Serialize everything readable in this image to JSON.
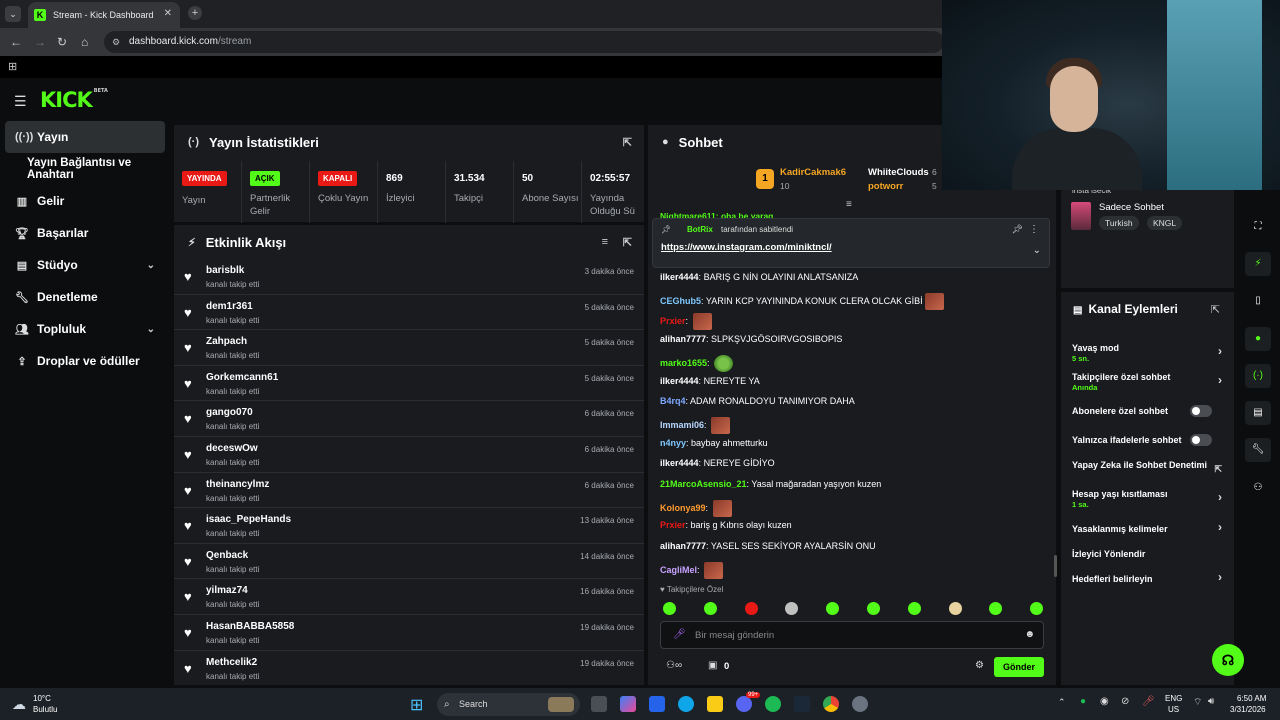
{
  "browser": {
    "tab_title": "Stream - Kick Dashboard",
    "url_host": "dashboard.kick.com",
    "url_path": "/stream"
  },
  "brand": {
    "logo": "KICK",
    "beta": "BETA",
    "accent": "#53fc18"
  },
  "sidebar": {
    "items": [
      {
        "label": "Yayın",
        "icon": "broadcast-icon",
        "active": true
      },
      {
        "label": "Yayın Bağlantısı ve Anahtarı"
      },
      {
        "label": "Gelir",
        "icon": "revenue-icon"
      },
      {
        "label": "Başarılar",
        "icon": "trophy-icon"
      },
      {
        "label": "Stüdyo",
        "icon": "studio-icon"
      },
      {
        "label": "Denetleme",
        "icon": "wrench-icon"
      },
      {
        "label": "Topluluk",
        "icon": "community-icon"
      },
      {
        "label": "Droplar ve ödüller",
        "icon": "drops-icon"
      }
    ]
  },
  "stats": {
    "title": "Yayın İstatistikleri",
    "items": [
      {
        "badge": "YAYINDA",
        "label": "Yayın"
      },
      {
        "badge": "AÇIK",
        "label": "Partnerlik Gelir"
      },
      {
        "badge": "KAPALI",
        "label": "Çoklu Yayın"
      },
      {
        "value": "869",
        "label": "İzleyici"
      },
      {
        "value": "31.534",
        "label": "Takipçi"
      },
      {
        "value": "50",
        "label": "Abone Sayısı"
      },
      {
        "value": "02:55:57",
        "label": "Yayında Olduğu Sü"
      }
    ]
  },
  "activity": {
    "title": "Etkinlik Akışı",
    "event_label": "kanalı takip etti",
    "rows": [
      {
        "name": "barisblk",
        "time": "3 dakika önce"
      },
      {
        "name": "dem1r361",
        "time": "5 dakika önce"
      },
      {
        "name": "Zahpach",
        "time": "5 dakika önce"
      },
      {
        "name": "Gorkemcann61",
        "time": "5 dakika önce"
      },
      {
        "name": "gango070",
        "time": "6 dakika önce"
      },
      {
        "name": "deceswOw",
        "time": "6 dakika önce"
      },
      {
        "name": "theinancylmz",
        "time": "6 dakika önce"
      },
      {
        "name": "isaac_PepeHands",
        "time": "13 dakika önce"
      },
      {
        "name": "Qenback",
        "time": "14 dakika önce"
      },
      {
        "name": "yilmaz74",
        "time": "16 dakika önce"
      },
      {
        "name": "HasanBABBA5858",
        "time": "19 dakika önce"
      },
      {
        "name": "Methcelik2",
        "time": "19 dakika önce"
      }
    ]
  },
  "chat": {
    "title": "Sohbet",
    "top_gifters": [
      {
        "rank": "1",
        "name": "KadirCakmak6",
        "count": "10"
      },
      {
        "name": "WhiiteClouds",
        "count": "6"
      },
      {
        "name": "potworr",
        "count": "5"
      }
    ],
    "partial_top": "Nightmare611: oha be yarag",
    "pinned": {
      "by": "BotRix",
      "by_suffix": "tarafından sabitlendi",
      "link": "https://www.instagram.com/miniktncl/"
    },
    "messages": [
      {
        "user": "ilker4444",
        "color": "#ffffff",
        "text": "BARIŞ G NİN OLAYINI ANLATSANIZA"
      },
      {
        "user": "CEGhub5",
        "color": "#7ec8ff",
        "text": "YARIN KCP YAYININDA KONUK CLERA OLCAK GİBİ",
        "emote": true
      },
      {
        "user": "Prxier",
        "color": "#e91916",
        "text": "",
        "emote": true
      },
      {
        "user": "alihan7777",
        "color": "#ffffff",
        "text": "SLPKŞVJGÖSOIRVGOSIBOPIS"
      },
      {
        "user": "marko1655",
        "color": "#53fc18",
        "text": "",
        "emote": "frog"
      },
      {
        "user": "ilker4444",
        "color": "#ffffff",
        "text": "NEREYTE YA"
      },
      {
        "user": "B4rq4",
        "color": "#7ea8ff",
        "text": "ADAM RONALDOYU TANIMIYOR DAHA"
      },
      {
        "user": "Immami06",
        "color": "#b8d8ff",
        "text": "",
        "emote": true
      },
      {
        "user": "n4nyy",
        "color": "#7ec8ff",
        "text": "baybay ahmetturku"
      },
      {
        "user": "ilker4444",
        "color": "#ffffff",
        "text": "NEREYE GİDİYO"
      },
      {
        "user": "21MarcoAsensio_21",
        "color": "#53fc18",
        "text": "Yasal mağaradan yaşıyon kuzen"
      },
      {
        "user": "Kolonya99",
        "color": "#ff9a2e",
        "text": "",
        "emote": true
      },
      {
        "user": "Prxier",
        "color": "#e91916",
        "text": "bariş g Kıbrıs olayı kuzen"
      },
      {
        "user": "alihan7777",
        "color": "#ffffff",
        "text": "YASEL SES SEKİYOR AYALARSİN ONU"
      },
      {
        "user": "CagliMel",
        "color": "#c9a3ff",
        "text": "",
        "emote": true
      }
    ],
    "followers_only": "Takipçilere Özel",
    "input_placeholder": "Bir mesaj gönderin",
    "points": "0",
    "send_label": "Gönder"
  },
  "chat_mode_panel": {
    "partial_label": "insta isecik",
    "title": "Sadece Sohbet",
    "tags": [
      "Turkish",
      "KNGL"
    ]
  },
  "channel_actions": {
    "title": "Kanal Eylemleri",
    "items": [
      {
        "label": "Yavaş mod",
        "sub": "5 sn.",
        "control": "chevron"
      },
      {
        "label": "Takipçilere özel sohbet",
        "sub": "Anında",
        "control": "chevron"
      },
      {
        "label": "Abonelere özel sohbet",
        "control": "toggle"
      },
      {
        "label": "Yalnızca ifadelerle sohbet",
        "control": "toggle"
      },
      {
        "label": "Yapay Zeka ile Sohbet Denetimi",
        "control": "external"
      },
      {
        "label": "Hesap yaşı kısıtlaması",
        "sub": "1 sa.",
        "control": "chevron"
      },
      {
        "label": "Yasaklanmış kelimeler",
        "control": "chevron"
      },
      {
        "label": "İzleyici Yönlendir",
        "control": "none"
      },
      {
        "label": "Hedefleri belirleyin",
        "control": "chevron"
      }
    ]
  },
  "taskbar": {
    "weather_temp": "10°C",
    "weather_desc": "Bulutlu",
    "search": "Search",
    "lang": "ENG",
    "region": "US",
    "time": "6:50 AM",
    "date": "3/31/2026",
    "notif_count": "99+"
  }
}
